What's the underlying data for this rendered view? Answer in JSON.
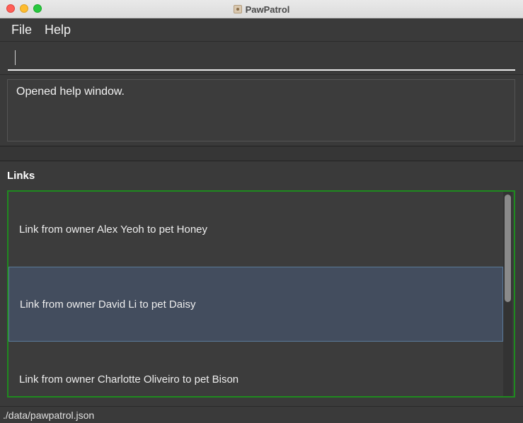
{
  "window": {
    "title": "PawPatrol",
    "app_icon": "app-icon"
  },
  "menu": {
    "file_label": "File",
    "help_label": "Help"
  },
  "command": {
    "value": "",
    "placeholder": ""
  },
  "result": {
    "text": "Opened help window."
  },
  "links": {
    "heading": "Links",
    "items": [
      {
        "label": "Link from owner Alex Yeoh to pet Honey",
        "selected": false
      },
      {
        "label": "Link from owner David Li to pet Daisy",
        "selected": true
      },
      {
        "label": "Link from owner Charlotte Oliveiro to pet Bison",
        "selected": false
      }
    ]
  },
  "status": {
    "path": "./data/pawpatrol.json"
  },
  "colors": {
    "accent_border": "#1f8a1f",
    "selection": "#434d5e",
    "background": "#3a3a3a"
  }
}
